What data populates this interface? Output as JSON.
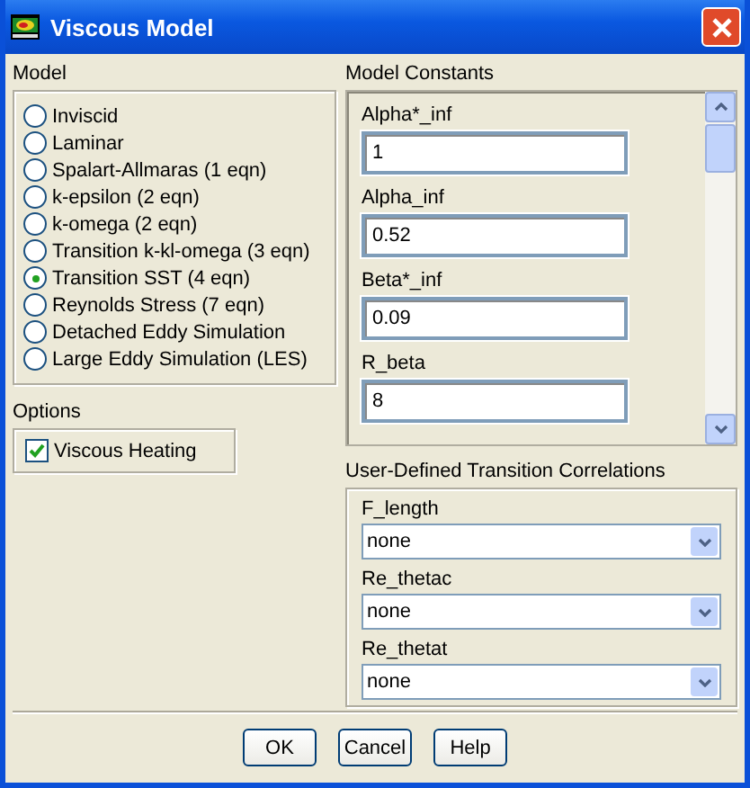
{
  "window": {
    "title": "Viscous Model"
  },
  "model": {
    "label": "Model",
    "options": [
      {
        "label": "Inviscid",
        "selected": false
      },
      {
        "label": "Laminar",
        "selected": false
      },
      {
        "label": "Spalart-Allmaras (1 eqn)",
        "selected": false
      },
      {
        "label": "k-epsilon (2 eqn)",
        "selected": false
      },
      {
        "label": "k-omega (2 eqn)",
        "selected": false
      },
      {
        "label": "Transition k-kl-omega (3 eqn)",
        "selected": false
      },
      {
        "label": "Transition SST (4 eqn)",
        "selected": true
      },
      {
        "label": "Reynolds Stress (7 eqn)",
        "selected": false
      },
      {
        "label": "Detached Eddy Simulation",
        "selected": false
      },
      {
        "label": "Large Eddy Simulation (LES)",
        "selected": false
      }
    ]
  },
  "options": {
    "label": "Options",
    "items": [
      {
        "label": "Viscous Heating",
        "checked": true
      }
    ]
  },
  "model_constants": {
    "label": "Model Constants",
    "fields": [
      {
        "label": "Alpha*_inf",
        "value": "1"
      },
      {
        "label": "Alpha_inf",
        "value": "0.52"
      },
      {
        "label": "Beta*_inf",
        "value": "0.09"
      },
      {
        "label": "R_beta",
        "value": "8"
      }
    ]
  },
  "correlations": {
    "label": "User-Defined Transition Correlations",
    "fields": [
      {
        "label": "F_length",
        "value": "none"
      },
      {
        "label": "Re_thetac",
        "value": "none"
      },
      {
        "label": "Re_thetat",
        "value": "none"
      }
    ]
  },
  "buttons": [
    "OK",
    "Cancel",
    "Help"
  ]
}
